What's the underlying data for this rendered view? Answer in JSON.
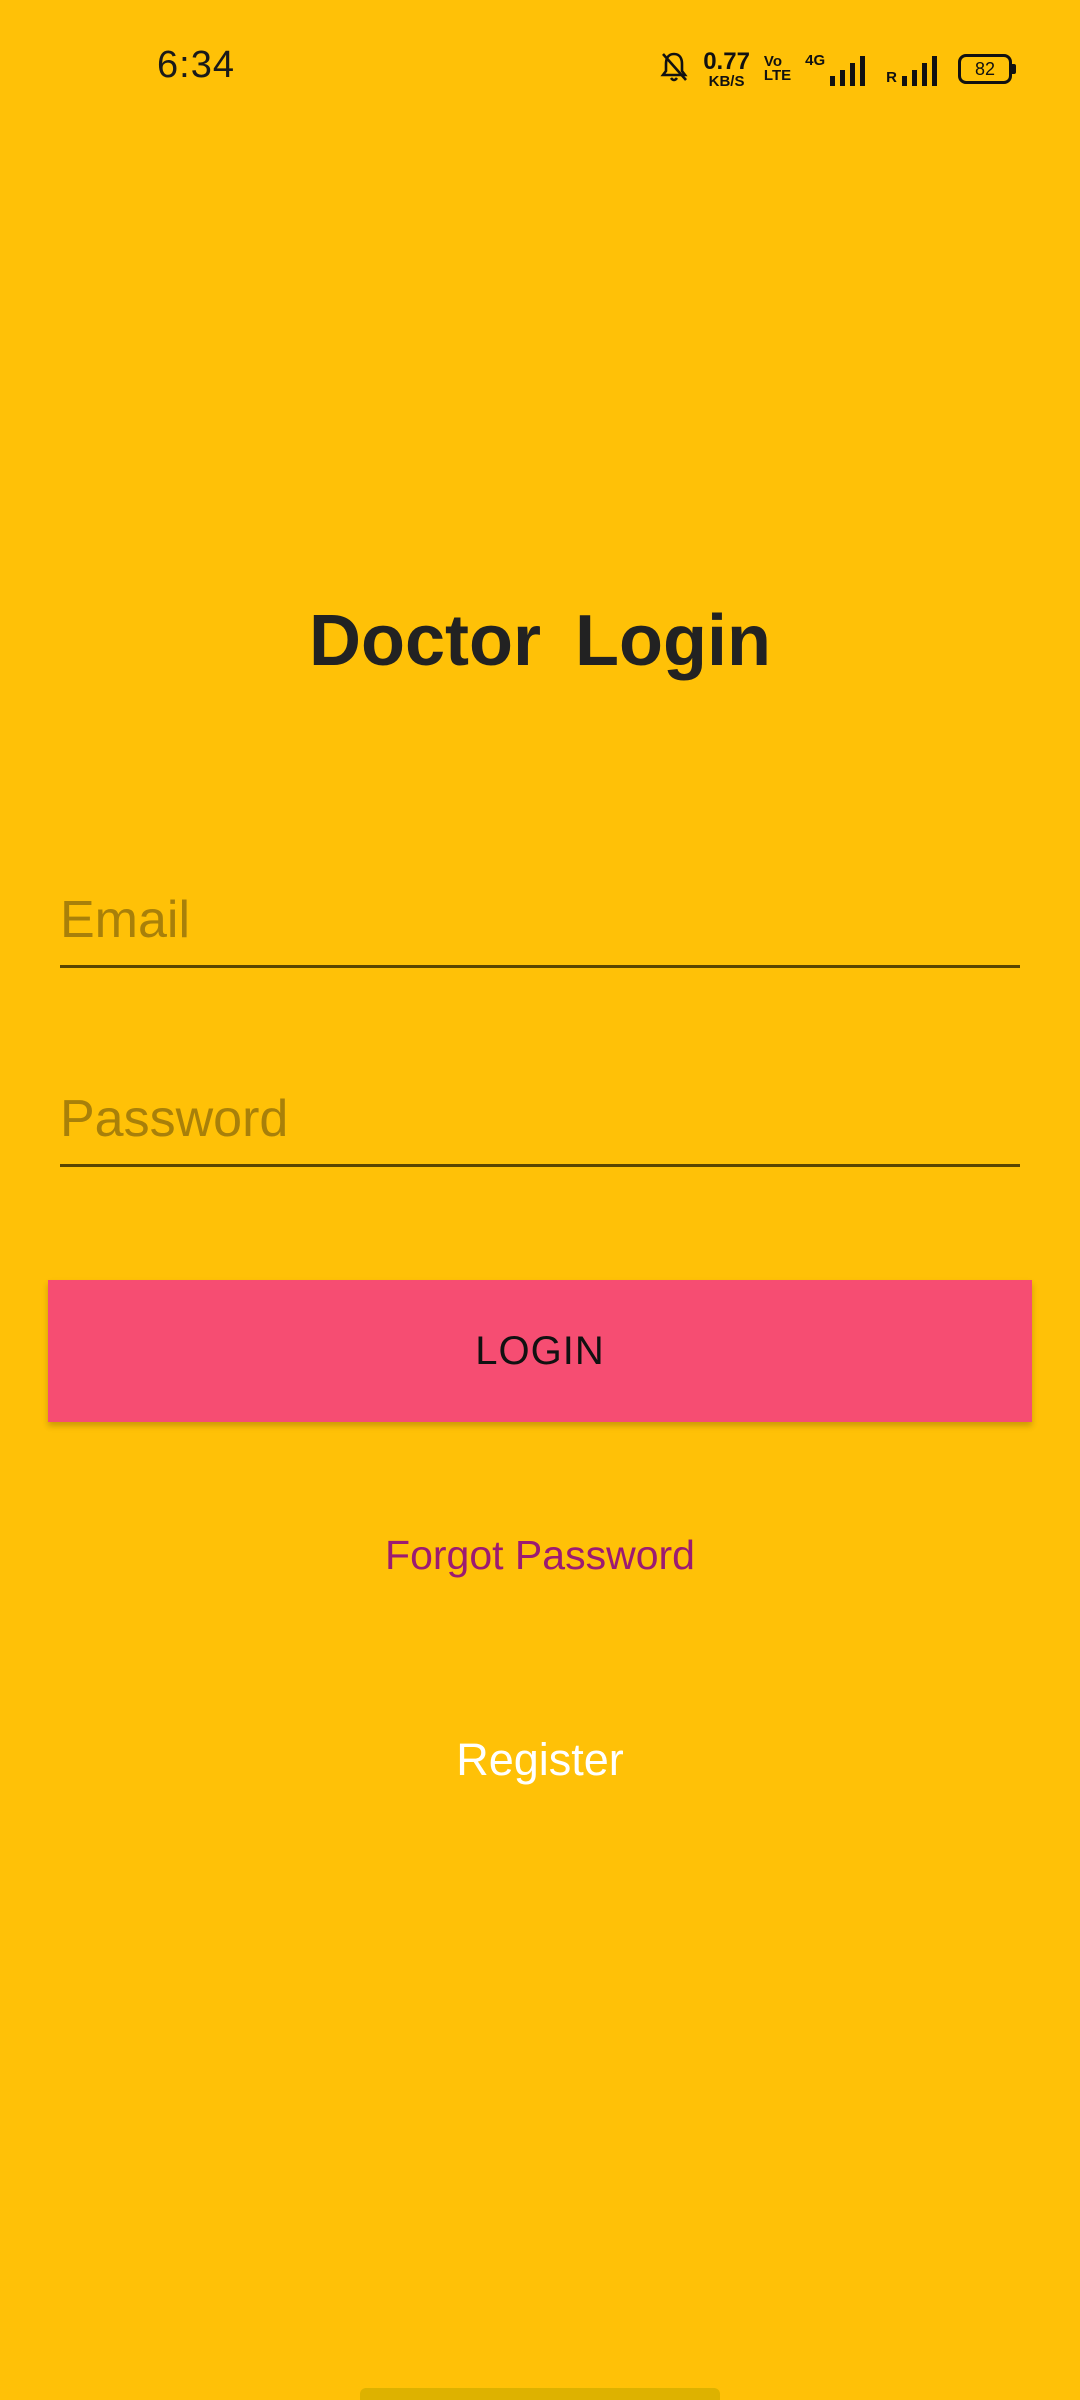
{
  "status_bar": {
    "time": "6:34",
    "net_speed_value": "0.77",
    "net_speed_unit": "KB/S",
    "volte_top": "Vo",
    "volte_bottom": "LTE",
    "network_type": "4G",
    "roaming": "R",
    "battery": "82",
    "icons": [
      "mute-bell-icon",
      "signal-icon",
      "signal-icon",
      "battery-icon"
    ]
  },
  "page": {
    "title": "Doctor  Login"
  },
  "form": {
    "email_placeholder": "Email",
    "password_placeholder": "Password",
    "login_label": "LOGIN",
    "forgot_label": "Forgot Password",
    "register_label": "Register"
  },
  "colors": {
    "background": "#FFC107",
    "login_button": "#F64D72",
    "forgot_text": "#9C1B72",
    "register_text": "#FFFFFF",
    "placeholder": "#A8800A"
  }
}
